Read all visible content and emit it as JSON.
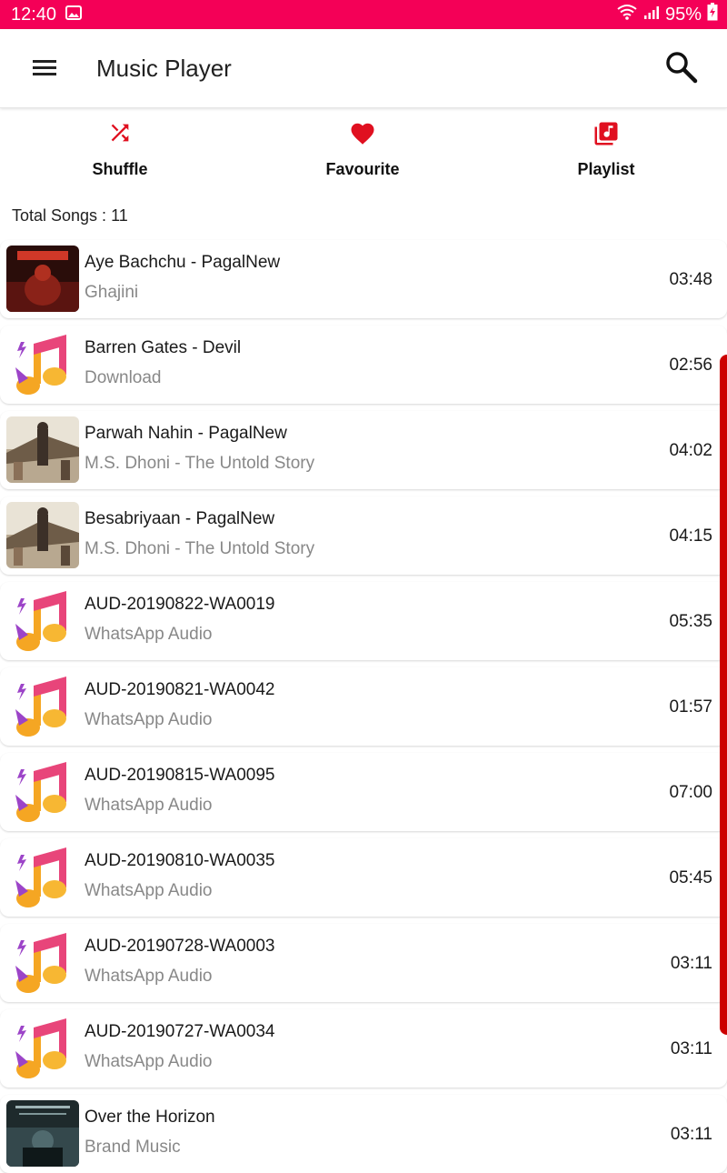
{
  "status_bar": {
    "time": "12:40",
    "battery": "95%"
  },
  "app_bar": {
    "title": "Music Player"
  },
  "actions": [
    {
      "label": "Shuffle",
      "icon": "shuffle-icon"
    },
    {
      "label": "Favourite",
      "icon": "heart-icon"
    },
    {
      "label": "Playlist",
      "icon": "playlist-icon"
    }
  ],
  "total_songs_text": "Total Songs : 11",
  "songs": [
    {
      "title": "Aye Bachchu - PagalNew",
      "album": "Ghajini",
      "duration": "03:48",
      "art": "ghajini-art"
    },
    {
      "title": "Barren Gates - Devil",
      "album": "Download",
      "duration": "02:56",
      "art": "music-note-art"
    },
    {
      "title": "Parwah Nahin - PagalNew",
      "album": "M.S. Dhoni - The Untold Story",
      "duration": "04:02",
      "art": "dhoni-art"
    },
    {
      "title": "Besabriyaan - PagalNew",
      "album": "M.S. Dhoni - The Untold Story",
      "duration": "04:15",
      "art": "dhoni-art"
    },
    {
      "title": "AUD-20190822-WA0019",
      "album": "WhatsApp Audio",
      "duration": "05:35",
      "art": "music-note-art"
    },
    {
      "title": "AUD-20190821-WA0042",
      "album": "WhatsApp Audio",
      "duration": "01:57",
      "art": "music-note-art"
    },
    {
      "title": "AUD-20190815-WA0095",
      "album": "WhatsApp Audio",
      "duration": "07:00",
      "art": "music-note-art"
    },
    {
      "title": "AUD-20190810-WA0035",
      "album": "WhatsApp Audio",
      "duration": "05:45",
      "art": "music-note-art"
    },
    {
      "title": "AUD-20190728-WA0003",
      "album": "WhatsApp Audio",
      "duration": "03:11",
      "art": "music-note-art"
    },
    {
      "title": "AUD-20190727-WA0034",
      "album": "WhatsApp Audio",
      "duration": "03:11",
      "art": "music-note-art"
    },
    {
      "title": "Over the Horizon",
      "album": "Brand Music",
      "duration": "03:11",
      "art": "horizon-art"
    }
  ],
  "colors": {
    "status_bar": "#f40057",
    "accent": "#e01020",
    "scroll_indicator": "#cc0000"
  }
}
